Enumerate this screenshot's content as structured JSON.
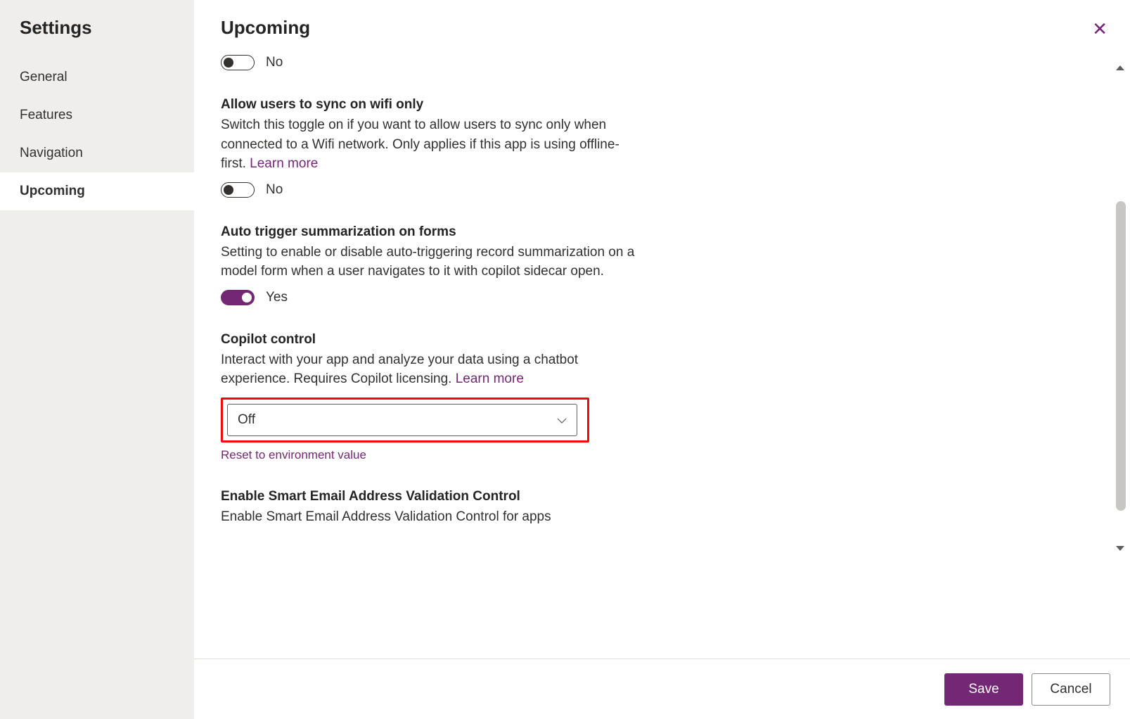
{
  "sidebar": {
    "title": "Settings",
    "items": [
      {
        "label": "General"
      },
      {
        "label": "Features"
      },
      {
        "label": "Navigation"
      },
      {
        "label": "Upcoming"
      }
    ]
  },
  "header": {
    "title": "Upcoming"
  },
  "settings": {
    "item0": {
      "toggle_state": "off",
      "toggle_label": "No"
    },
    "wifi": {
      "title": "Allow users to sync on wifi only",
      "desc_a": "Switch this toggle on if you want to allow users to sync only when connected to a Wifi network. Only applies if this app is using offline-first. ",
      "learn_more": "Learn more",
      "toggle_state": "off",
      "toggle_label": "No"
    },
    "summarize": {
      "title": "Auto trigger summarization on forms",
      "desc": "Setting to enable or disable auto-triggering record summarization on a model form when a user navigates to it with copilot sidecar open.",
      "toggle_state": "on",
      "toggle_label": "Yes"
    },
    "copilot": {
      "title": "Copilot control",
      "desc_a": "Interact with your app and analyze your data using a chatbot experience. Requires Copilot licensing. ",
      "learn_more": "Learn more",
      "select_value": "Off",
      "reset_label": "Reset to environment value"
    },
    "email": {
      "title": "Enable Smart Email Address Validation Control",
      "desc": "Enable Smart Email Address Validation Control for apps"
    }
  },
  "footer": {
    "save": "Save",
    "cancel": "Cancel"
  },
  "colors": {
    "accent": "#742774",
    "highlight_border": "#ef0909"
  }
}
